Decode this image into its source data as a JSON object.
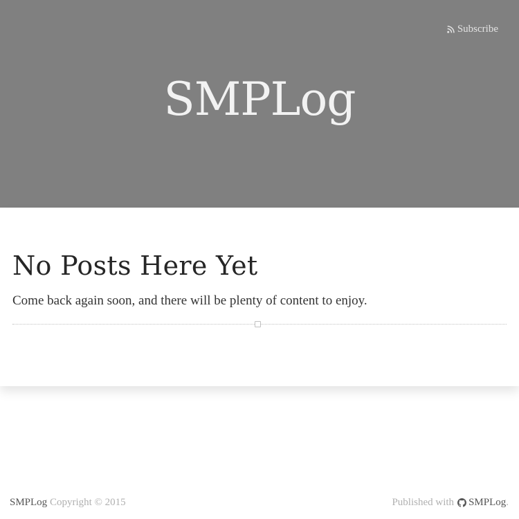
{
  "header": {
    "subscribe_label": "Subscribe",
    "site_title": "SMPLog",
    "background_color": "#808080",
    "subscribe_icon": "rss-icon"
  },
  "main": {
    "headline": "No Posts Here Yet",
    "message": "Come back again soon, and there will be plenty of content to enjoy."
  },
  "footer": {
    "brand_left": "SMPLog",
    "copyright": "Copyright © 2015",
    "published_prefix": "Published with",
    "brand_right": "SMPLog",
    "trailing_punct": ".",
    "published_icon": "github-icon"
  }
}
